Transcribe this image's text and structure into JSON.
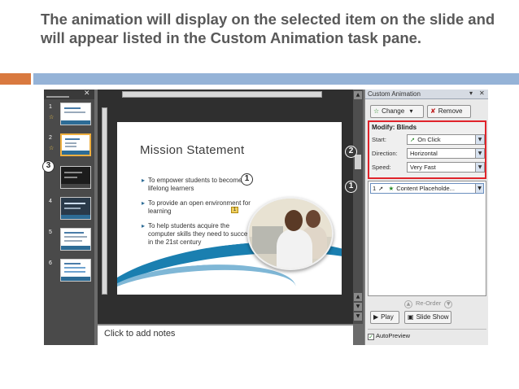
{
  "caption": "The animation will display on the selected item on the slide and will appear listed in the Custom Animation task pane.",
  "slides_pane": {
    "slides": [
      {
        "number": "1",
        "selected": false,
        "dark": false
      },
      {
        "number": "2",
        "selected": true,
        "dark": false
      },
      {
        "number": "3",
        "selected": false,
        "dark": true
      },
      {
        "number": "4",
        "selected": false,
        "dark": false
      },
      {
        "number": "5",
        "selected": false,
        "dark": false
      },
      {
        "number": "6",
        "selected": false,
        "dark": false
      }
    ]
  },
  "slide": {
    "title": "Mission Statement",
    "bullets": [
      "To empower students to become lifelong learners",
      "To provide an open environment for learning",
      "To help students acquire the computer skills they need to succeed in the 21st century"
    ],
    "marker": "1"
  },
  "notes": {
    "placeholder": "Click to add notes"
  },
  "task_pane": {
    "title": "Custom Animation",
    "change_label": "Change",
    "remove_label": "Remove",
    "modify_label": "Modify: Blinds",
    "start_label": "Start:",
    "start_value": "On Click",
    "direction_label": "Direction:",
    "direction_value": "Horizontal",
    "speed_label": "Speed:",
    "speed_value": "Very Fast",
    "list_item_number": "1",
    "list_item_label": "Content Placeholde...",
    "reorder_label": "Re-Order",
    "play_label": "Play",
    "slideshow_label": "Slide Show",
    "autopreview_label": "AutoPreview"
  },
  "callouts": [
    "1",
    "2",
    "3",
    "1"
  ]
}
